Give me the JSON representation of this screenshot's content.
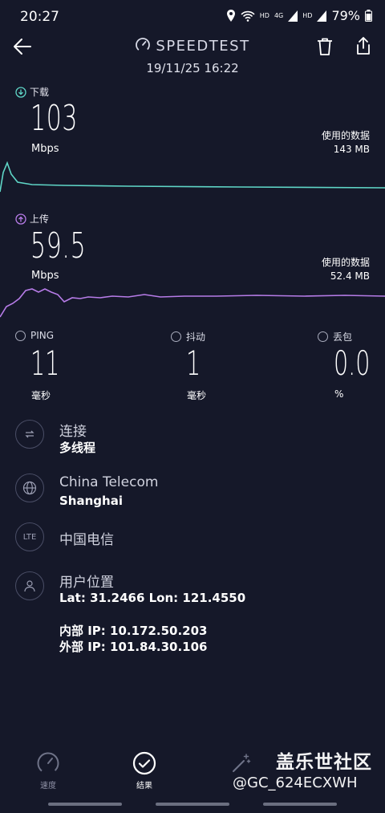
{
  "status": {
    "time": "20:27",
    "battery": "79%",
    "net1": "HD",
    "net2": "4G",
    "net3": "HD"
  },
  "header": {
    "brand": "SPEEDTEST",
    "date": "19/11/25 16:22"
  },
  "download": {
    "label": "下载",
    "value": "103",
    "unit": "Mbps",
    "used_label": "使用的数据",
    "used_value": "143 MB",
    "color": "#5fd6c7"
  },
  "upload": {
    "label": "上传",
    "value": "59.5",
    "unit": "Mbps",
    "used_label": "使用的数据",
    "used_value": "52.4 MB",
    "color": "#b77ce8"
  },
  "ping": {
    "label": "PING",
    "value": "11",
    "unit": "毫秒"
  },
  "jitter": {
    "label": "抖动",
    "value": "1",
    "unit": "毫秒"
  },
  "loss": {
    "label": "丢包",
    "value": "0.0",
    "unit": "%"
  },
  "info": {
    "connection": {
      "title": "连接",
      "value": "多线程"
    },
    "isp": {
      "title": "China Telecom",
      "value": "Shanghai"
    },
    "carrier": {
      "icon_text": "LTE",
      "title": "中国电信"
    },
    "location": {
      "title": "用户位置",
      "value": "Lat: 31.2466 Lon: 121.4550"
    },
    "internal_ip": "内部 IP: 10.172.50.203",
    "external_ip": "外部 IP: 101.84.30.106"
  },
  "nav": {
    "speed": "速度",
    "results": "结果",
    "third": ""
  },
  "watermark": {
    "line1": "盖乐世社区",
    "line2": "@GC_624ECXWH"
  }
}
